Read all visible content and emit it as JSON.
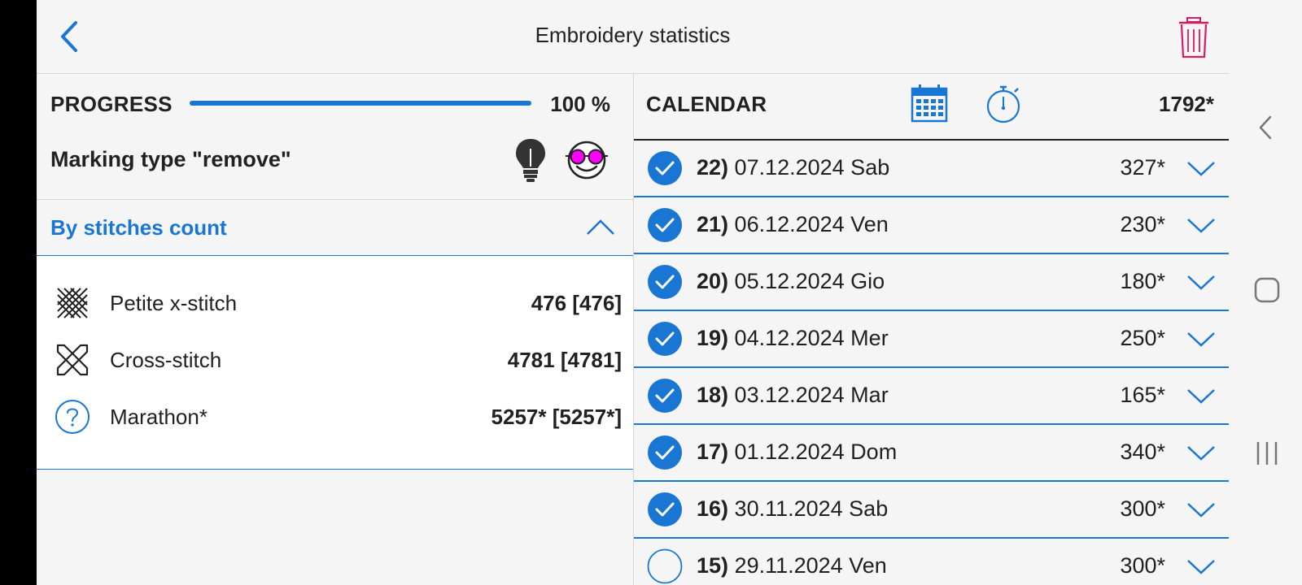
{
  "header": {
    "title": "Embroidery statistics"
  },
  "progress": {
    "label": "PROGRESS",
    "percent": 100,
    "value_text": "100 %"
  },
  "marking": {
    "label": "Marking type \"remove\""
  },
  "section": {
    "title": "By stitches count"
  },
  "stitches": [
    {
      "name": "Petite x-stitch",
      "count": "476 [476]",
      "icon": "petite-stitch-icon"
    },
    {
      "name": "Cross-stitch",
      "count": "4781 [4781]",
      "icon": "cross-stitch-icon"
    },
    {
      "name": "Marathon*",
      "count": "5257* [5257*]",
      "icon": "question-icon"
    }
  ],
  "calendar": {
    "label": "CALENDAR",
    "total": "1792*",
    "days": [
      {
        "num": "22)",
        "date": "07.12.2024 Sab",
        "count": "327*",
        "done": true
      },
      {
        "num": "21)",
        "date": "06.12.2024 Ven",
        "count": "230*",
        "done": true
      },
      {
        "num": "20)",
        "date": "05.12.2024 Gio",
        "count": "180*",
        "done": true
      },
      {
        "num": "19)",
        "date": "04.12.2024 Mer",
        "count": "250*",
        "done": true
      },
      {
        "num": "18)",
        "date": "03.12.2024 Mar",
        "count": "165*",
        "done": true
      },
      {
        "num": "17)",
        "date": "01.12.2024 Dom",
        "count": "340*",
        "done": true
      },
      {
        "num": "16)",
        "date": "30.11.2024 Sab",
        "count": "300*",
        "done": true
      },
      {
        "num": "15)",
        "date": "29.11.2024 Ven",
        "count": "300*",
        "done": false
      }
    ]
  },
  "colors": {
    "accent": "#1976d2",
    "delete": "#d81b60",
    "glasses": "#ff00ff"
  }
}
